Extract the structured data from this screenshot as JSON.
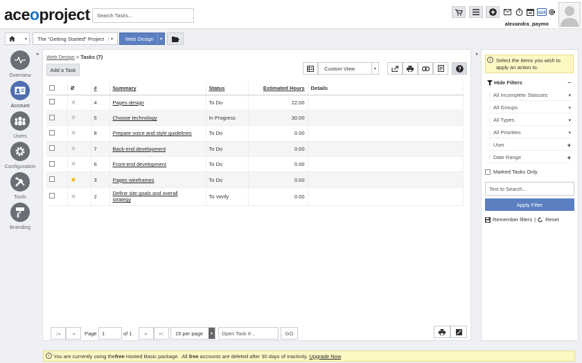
{
  "app": {
    "logo_left": "ace",
    "logo_o": "o",
    "logo_right": "project",
    "search_placeholder": "Search Tasks...",
    "user_name": "alexandra_paymo"
  },
  "project_bar": {
    "project": "The \"Getting Started\" Project",
    "module": "Web Design"
  },
  "nav": [
    {
      "label": "Overview",
      "icon": "pulse-icon"
    },
    {
      "label": "Account",
      "icon": "id-card-icon"
    },
    {
      "label": "Users",
      "icon": "users-icon"
    },
    {
      "label": "Configuration",
      "icon": "gear-icon"
    },
    {
      "label": "Tools",
      "icon": "tools-icon"
    },
    {
      "label": "Branding",
      "icon": "paint-roller-icon"
    }
  ],
  "breadcrumb": {
    "parent": "Web Design",
    "sep": ">",
    "current": "Tasks",
    "count": "(7)"
  },
  "toolbar": {
    "add_task": "Add a Task",
    "view": "Custom View"
  },
  "table": {
    "headers": {
      "sort": "⇵",
      "num": "#",
      "summary": "Summary",
      "status": "Status",
      "hours": "Estimated Hours",
      "details": "Details"
    },
    "rows": [
      {
        "num": "4",
        "summary": "Pages design",
        "summary2": "",
        "status": "To Do",
        "hours": "22.00",
        "starred": false
      },
      {
        "num": "5",
        "summary": "Choose technology",
        "summary2": "",
        "status": "In Progress",
        "hours": "30.00",
        "starred": false
      },
      {
        "num": "8",
        "summary": "Prepare voice and style guidelines",
        "summary2": "",
        "status": "To Do",
        "hours": "0.00",
        "starred": false
      },
      {
        "num": "7",
        "summary": "Back-end development",
        "summary2": "",
        "status": "To Do",
        "hours": "0.00",
        "starred": false
      },
      {
        "num": "6",
        "summary": "Front-end development",
        "summary2": "",
        "status": "To Do",
        "hours": "0.00",
        "starred": false
      },
      {
        "num": "3",
        "summary": "Pages wireframes",
        "summary2": "",
        "status": "To Do",
        "hours": "0.00",
        "starred": true
      },
      {
        "num": "2",
        "summary": "Define site goals and overall",
        "summary2": "strategy",
        "status": "To Verify",
        "hours": "0.00",
        "starred": false
      }
    ]
  },
  "pagination": {
    "page_label": "Page",
    "page": "1",
    "of_label": "of 1",
    "per_page": "15 per page",
    "open_task_placeholder": "Open Task #...",
    "go": "GO"
  },
  "filters": {
    "hint": "Select the items you wish to apply an action to.",
    "hide_filters": "Hide Filters",
    "items": [
      {
        "label": "All Incomplete Statuses",
        "control": "▾"
      },
      {
        "label": "All Groups",
        "control": "▾"
      },
      {
        "label": "All Types",
        "control": "▾"
      },
      {
        "label": "All Priorities",
        "control": "▾"
      },
      {
        "label": "User",
        "control": "+"
      },
      {
        "label": "Date Range",
        "control": "+"
      }
    ],
    "marked_only": "Marked Tasks Only",
    "text_search_placeholder": "Text to Search...",
    "apply": "Apply Filter",
    "remember": "Remember filters",
    "separator": "|",
    "reset": "Reset"
  },
  "footer": {
    "t1": "You are currently using the ",
    "b1": "free",
    "t2": " Hosted Basic package.  All ",
    "b2": "free",
    "t3": " accounts are deleted after 30 days of inactivity. ",
    "link": "Upgrade Now"
  },
  "colors": {
    "accent": "#5b7fc0",
    "logo_o": "#1c6fc7",
    "star": "#f2b400",
    "notice": "#fdf7c4"
  }
}
